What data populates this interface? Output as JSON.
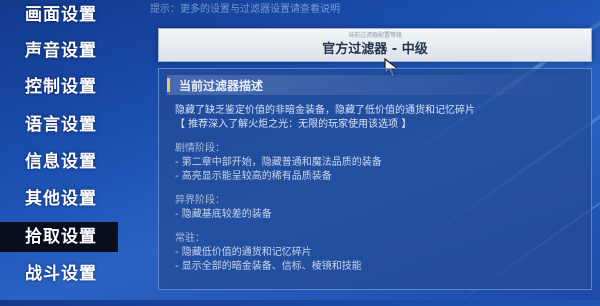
{
  "top_hint": "提示：更多的设置与过滤器设置请查看说明",
  "menu": {
    "items": [
      {
        "label": "画面设置",
        "active": false
      },
      {
        "label": "声音设置",
        "active": false
      },
      {
        "label": "控制设置",
        "active": false
      },
      {
        "label": "语言设置",
        "active": false
      },
      {
        "label": "信息设置",
        "active": false
      },
      {
        "label": "其他设置",
        "active": false
      },
      {
        "label": "拾取设置",
        "active": true
      },
      {
        "label": "战斗设置",
        "active": false
      }
    ]
  },
  "filter": {
    "small_caption": "当前过滤器配置等级",
    "title": "官方过滤器 - 中级"
  },
  "panel": {
    "title": "当前过滤器描述",
    "intro": "隐藏了缺乏鉴定价值的非暗金装备，隐藏了低价值的通货和记忆碎片",
    "recommend": "【 推荐深入了解火炬之光：无限的玩家使用该选项 】",
    "sections": [
      {
        "heading": "剧情阶段：",
        "lines": [
          "- 第二章中部开始，隐藏普通和魔法品质的装备",
          "- 高亮显示能呈较高的稀有品质装备"
        ]
      },
      {
        "heading": "异界阶段：",
        "lines": [
          "- 隐藏基底较差的装备"
        ]
      },
      {
        "heading": "常驻：",
        "lines": [
          "- 隐藏低价值的通货和记忆碎片",
          "- 显示全部的暗金装备、信标、棱镜和技能"
        ]
      }
    ]
  },
  "colors": {
    "active_menu_bg": "#0a0f1e",
    "panel_title_accent": "#e9c46a"
  }
}
